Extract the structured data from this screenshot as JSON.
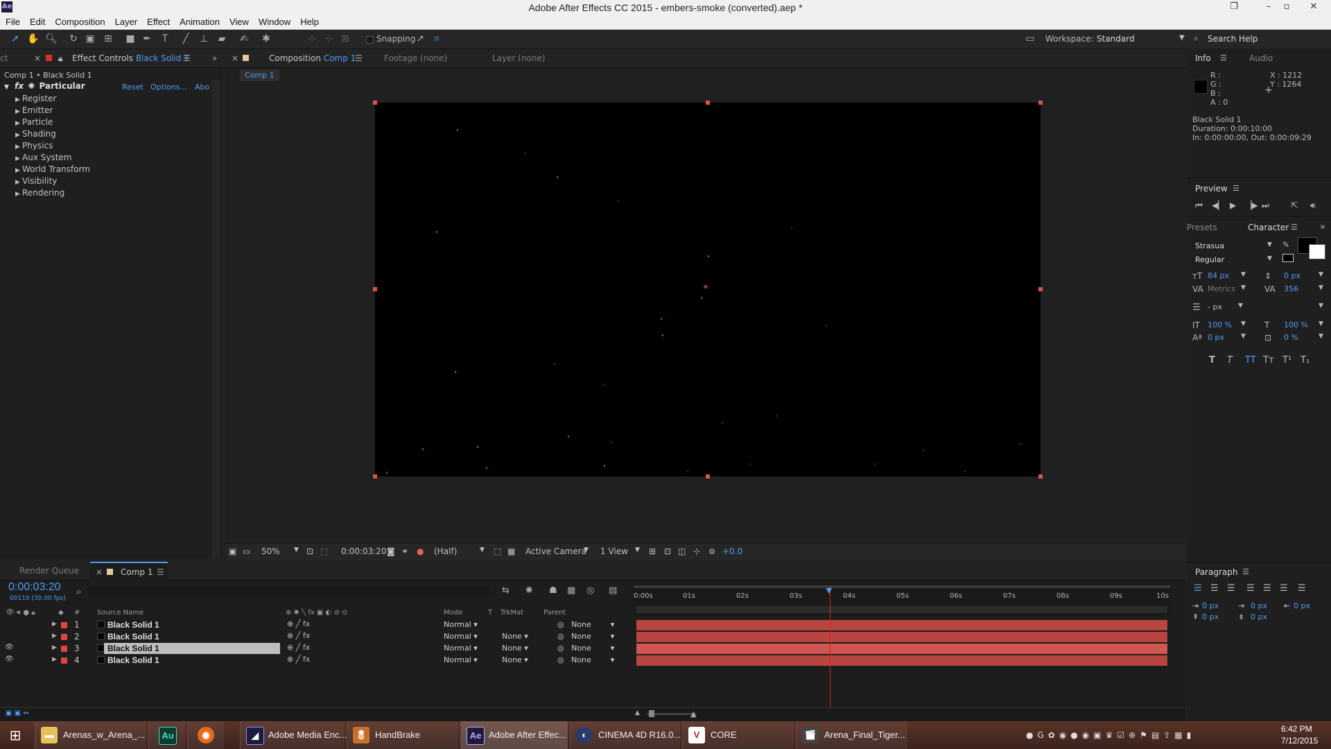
{
  "window": {
    "title": "Adobe After Effects CC 2015 - embers-smoke (converted).aep *",
    "app_icon": "Ae"
  },
  "menu": [
    "File",
    "Edit",
    "Composition",
    "Layer",
    "Effect",
    "Animation",
    "View",
    "Window",
    "Help"
  ],
  "toolbar": {
    "snapping": "Snapping",
    "workspace_label": "Workspace:",
    "workspace_value": "Standard",
    "search_help": "Search Help"
  },
  "effect_controls": {
    "tab_left": "ct",
    "tab_title": "Effect Controls",
    "tab_layer": "Black Solid 1",
    "breadcrumb": "Comp 1 • Black Solid 1",
    "effect_name": "Particular",
    "reset": "Reset",
    "options": "Options...",
    "about": "Abo",
    "groups": [
      "Register",
      "Emitter",
      "Particle",
      "Shading",
      "Physics",
      "Aux System",
      "World Transform",
      "Visibility",
      "Rendering"
    ]
  },
  "composition": {
    "tab_prefix": "Composition",
    "tab_name": "Comp 1",
    "footage": "Footage (none)",
    "layer": "Layer (none)",
    "sub_tab": "Comp 1",
    "zoom": "50%",
    "timecode": "0:00:03:20",
    "resolution": "(Half)",
    "camera": "Active Camera",
    "views": "1 View",
    "exposure": "+0.0"
  },
  "info": {
    "tab": "Info",
    "tab2": "Audio",
    "r": "R :",
    "g": "G :",
    "b": "B :",
    "a": "A : 0",
    "x": "X : 1212",
    "y": "Y : 1264",
    "layer": "Black Solid 1",
    "duration": "Duration: 0:00:10:00",
    "inout": "In: 0:00:00:00, Out: 0:00:09:29"
  },
  "preview": {
    "title": "Preview"
  },
  "character": {
    "tab_left": "Presets",
    "tab": "Character",
    "font": "Strasua",
    "style": "Regular",
    "size": "84 px",
    "leading": "0 px",
    "kerning": "Metrics",
    "tracking": "356",
    "stroke": "- px",
    "vscale": "100 %",
    "hscale": "100 %",
    "baseline": "0 px",
    "tsume": "0 %"
  },
  "paragraph": {
    "title": "Paragraph",
    "indent_left": "0 px",
    "indent_first": "0 px",
    "indent_right": "0 px",
    "space_before": "0 px",
    "space_after": "0 px"
  },
  "timeline": {
    "render_queue": "Render Queue",
    "comp_tab": "Comp 1",
    "timecode": "0:00:03:20",
    "frames": "00110 (30.00 fps)",
    "col_source": "Source Name",
    "col_mode": "Mode",
    "col_t": "T",
    "col_trkmat": "TrkMat",
    "col_parent": "Parent",
    "ruler": [
      "0:00s",
      "01s",
      "02s",
      "03s",
      "04s",
      "05s",
      "06s",
      "07s",
      "08s",
      "09s",
      "10s"
    ],
    "playhead_seconds": 3.67,
    "layers": [
      {
        "num": "1",
        "name": "Black Solid 1",
        "mode": "Normal",
        "trkmat": "",
        "parent": "None"
      },
      {
        "num": "2",
        "name": "Black Solid 1",
        "mode": "Normal",
        "trkmat": "None",
        "parent": "None"
      },
      {
        "num": "3",
        "name": "Black Solid 1",
        "mode": "Normal",
        "trkmat": "None",
        "parent": "None"
      },
      {
        "num": "4",
        "name": "Black Solid 1",
        "mode": "Normal",
        "trkmat": "None",
        "parent": "None"
      }
    ]
  },
  "taskbar": {
    "items": [
      {
        "label": "Arenas_w_Arena_...",
        "icon": "folder-icon"
      },
      {
        "label": "",
        "icon": "audition-icon",
        "glyph": "Au"
      },
      {
        "label": "",
        "icon": "firefox-icon"
      },
      {
        "label": "Adobe Media Enc...",
        "icon": "media-encoder-icon"
      },
      {
        "label": "HandBrake",
        "icon": "handbrake-icon"
      },
      {
        "label": "Adobe After Effec...",
        "icon": "after-effects-icon",
        "glyph": "Ae"
      },
      {
        "label": "CINEMA 4D R16.0...",
        "icon": "cinema4d-icon"
      },
      {
        "label": "CORE",
        "icon": "core-icon",
        "glyph": "V"
      },
      {
        "label": "Arena_Final_Tiger...",
        "icon": "clapper-icon"
      }
    ],
    "time": "6:42 PM",
    "date": "7/12/2015"
  }
}
